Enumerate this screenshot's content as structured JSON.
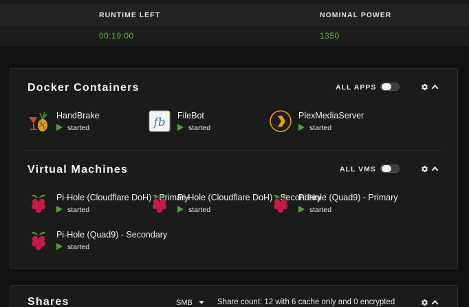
{
  "ups": {
    "runtime_left_label": "RUNTIME LEFT",
    "runtime_left_value": "00:19:00",
    "nominal_power_label": "NOMINAL POWER",
    "nominal_power_value": "1350"
  },
  "docker": {
    "title": "Docker Containers",
    "all_label": "ALL APPS",
    "containers": [
      {
        "name": "HandBrake",
        "status": "started",
        "icon": "handbrake-icon"
      },
      {
        "name": "FileBot",
        "status": "started",
        "icon": "filebot-icon"
      },
      {
        "name": "PlexMediaServer",
        "status": "started",
        "icon": "plex-icon"
      }
    ]
  },
  "vms": {
    "title": "Virtual Machines",
    "all_label": "ALL VMS",
    "machines": [
      {
        "name": "Pi-Hole (Cloudflare DoH) - Primary",
        "status": "started",
        "icon": "raspberry-icon"
      },
      {
        "name": "Pi-Hole (Cloudflare DoH) - Secondary",
        "status": "started",
        "icon": "raspberry-icon"
      },
      {
        "name": "Pi-Hole (Quad9) - Primary",
        "status": "started",
        "icon": "raspberry-icon"
      },
      {
        "name": "Pi-Hole (Quad9) - Secondary",
        "status": "started",
        "icon": "raspberry-icon"
      }
    ]
  },
  "shares": {
    "title": "Shares",
    "protocol": "SMB",
    "count_text": "Share count: 12 with 6 cache only and 0 encrypted"
  },
  "colors": {
    "accent_green": "#5db43a",
    "play_green": "#4fa33a",
    "plex_orange": "#e5a00d"
  }
}
